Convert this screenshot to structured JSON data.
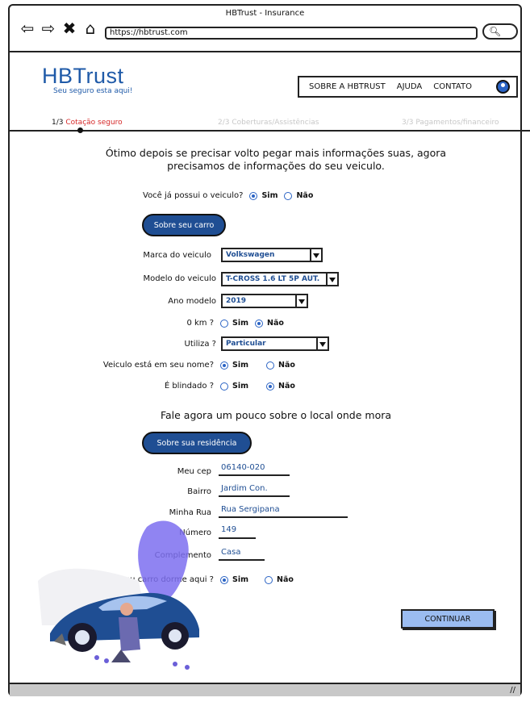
{
  "window": {
    "title": "HBTrust - Insurance",
    "url": "https://hbtrust.com"
  },
  "icons": {
    "back": "left-arrow-icon",
    "forward": "right-arrow-icon",
    "close": "x-icon",
    "home": "home-icon",
    "search": "search-icon",
    "user": "user-icon"
  },
  "brand": {
    "name": "HBTrust",
    "tagline": "Seu seguro esta aqui!",
    "color": "#1f5aa8"
  },
  "nav": {
    "items": [
      "SOBRE A HBTRUST",
      "AJUDA",
      "CONTATO"
    ]
  },
  "steps": [
    {
      "num": "1/3",
      "label": "Cotação seguro"
    },
    {
      "label": "2/3 Coberturas/Assistências"
    },
    {
      "label": "3/3 Pagamentos/financeiro"
    }
  ],
  "intro": "Ótimo depois se precisar volto pegar mais informações suas, agora precisamos de informações do seu veiculo.",
  "own_vehicle": {
    "label": "Você já possui o veiculo?",
    "yes": "Sim",
    "no": "Não",
    "selected": "yes"
  },
  "car_section": {
    "button": "Sobre seu carro"
  },
  "car": {
    "brand": {
      "label": "Marca do veiculo",
      "value": "Volkswagen"
    },
    "model": {
      "label": "Modelo do veiculo",
      "value": "T-CROSS 1.6 LT 5P AUT."
    },
    "year": {
      "label": "Ano modelo",
      "value": "2019"
    },
    "zero_km": {
      "label": "0 km ?",
      "yes": "Sim",
      "no": "Não",
      "selected": "no"
    },
    "usage": {
      "label": "Utiliza ?",
      "value": "Particular"
    },
    "in_name": {
      "label": "Veiculo está em seu nome?",
      "yes": "Sim",
      "no": "Não",
      "selected": "yes"
    },
    "armored": {
      "label": "É blindado ?",
      "yes": "Sim",
      "no": "Não",
      "selected": "no"
    }
  },
  "residence_title": "Fale agora um pouco sobre o local onde mora",
  "residence_section": {
    "button": "Sobre sua residência"
  },
  "residence": {
    "cep": {
      "label": "Meu cep",
      "value": "06140-020"
    },
    "bairro": {
      "label": "Bairro",
      "value": "Jardim Con."
    },
    "rua": {
      "label": "Minha Rua",
      "value": "Rua Sergipana"
    },
    "numero": {
      "label": "Número",
      "value": "149"
    },
    "complemento": {
      "label": "Complemento",
      "value": "Casa"
    },
    "garage": {
      "label": "Seu carro dorme aqui ?",
      "yes": "Sim",
      "no": "Não",
      "selected": "yes"
    }
  },
  "continue_label": "CONTINUAR"
}
